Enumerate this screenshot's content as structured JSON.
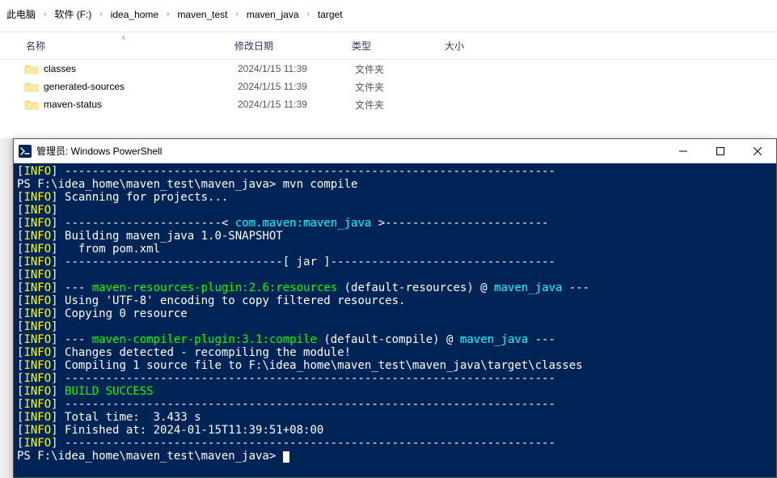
{
  "breadcrumb": [
    "此电脑",
    "软件 (F:)",
    "idea_home",
    "maven_test",
    "maven_java",
    "target"
  ],
  "columns": {
    "name": "名称",
    "date": "修改日期",
    "type": "类型",
    "size": "大小"
  },
  "files": [
    {
      "name": "classes",
      "date": "2024/1/15 11:39",
      "type": "文件夹"
    },
    {
      "name": "generated-sources",
      "date": "2024/1/15 11:39",
      "type": "文件夹"
    },
    {
      "name": "maven-status",
      "date": "2024/1/15 11:39",
      "type": "文件夹"
    }
  ],
  "terminal": {
    "title": "管理员: Windows PowerShell",
    "lines": {
      "dashes1": "------------------------------------------------------------------------",
      "prompt1": "PS F:\\idea_home\\maven_test\\maven_java> mvn compile",
      "scanning": "Scanning for projects...",
      "empty": "",
      "dashPre": "-----------------------< ",
      "artifact": "com.maven:maven_java",
      "dashPost": " >------------------------",
      "building": "Building maven_java 1.0-SNAPSHOT",
      "frompom": "  from pom.xml",
      "jar": "--------------------------------[ jar ]---------------------------------",
      "resPre": "--- ",
      "resPlugin": "maven-resources-plugin:2.6:resources",
      "resMid": " (default-resources) @ ",
      "resProj": "maven_java",
      "resEnd": " ---",
      "utf8": "Using 'UTF-8' encoding to copy filtered resources.",
      "copy0": "Copying 0 resource",
      "compPlugin": "maven-compiler-plugin:3.1:compile",
      "compMid": " (default-compile) @ ",
      "changes": "Changes detected - recompiling the module!",
      "compiling": "Compiling 1 source file to F:\\idea_home\\maven_test\\maven_java\\target\\classes",
      "dashes2": "------------------------------------------------------------------------",
      "success": "BUILD SUCCESS",
      "total": "Total time:  3.433 s",
      "finished": "Finished at: 2024-01-15T11:39:51+08:00",
      "prompt2": "PS F:\\idea_home\\maven_test\\maven_java> "
    }
  }
}
